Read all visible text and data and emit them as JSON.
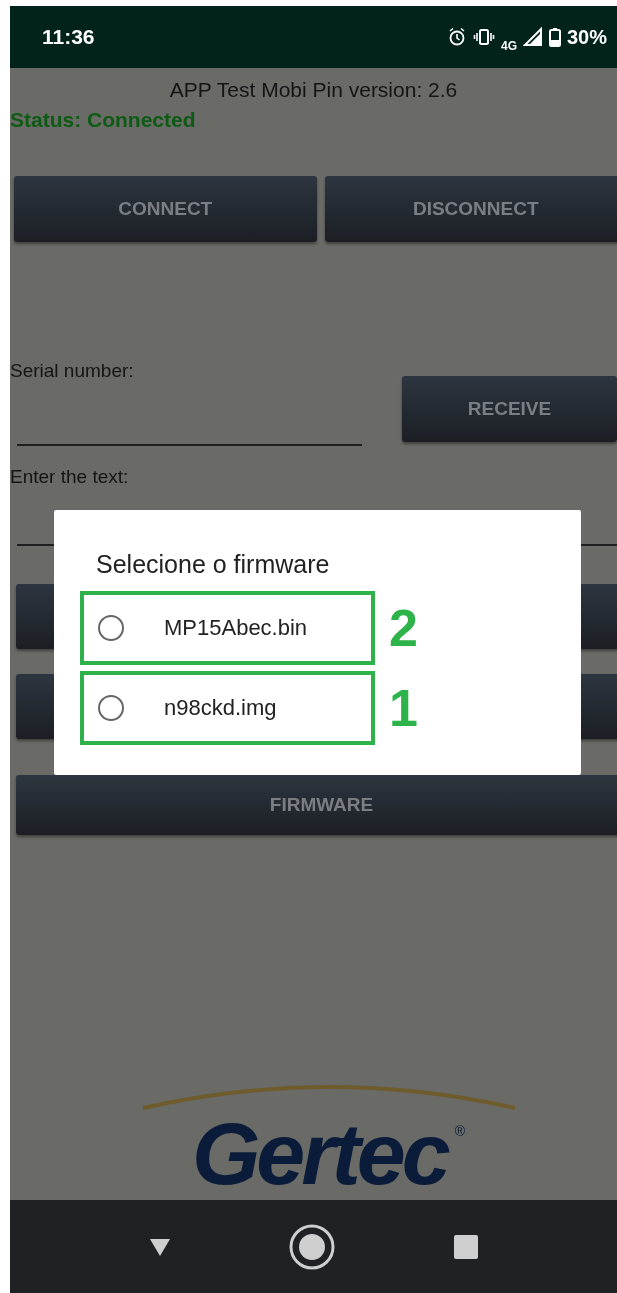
{
  "status_bar": {
    "time": "11:36",
    "network": "4G",
    "battery": "30%"
  },
  "app": {
    "title": "APP Test Mobi Pin version: 2.6",
    "status": "Status: Connected",
    "top_buttons": [
      "CONNECT",
      "DISCONNECT"
    ],
    "serial_label": "Serial number:",
    "receive_button": "RECEIVE",
    "text_label": "Enter the text:",
    "firmware_button": "FIRMWARE",
    "logo": "Gertec",
    "logo_mark": "®"
  },
  "dialog": {
    "title": "Selecione o firmware",
    "options": [
      {
        "label": "MP15Abec.bin",
        "selected": false,
        "annotation": "2"
      },
      {
        "label": "n98ckd.img",
        "selected": false,
        "annotation": "1"
      }
    ]
  }
}
